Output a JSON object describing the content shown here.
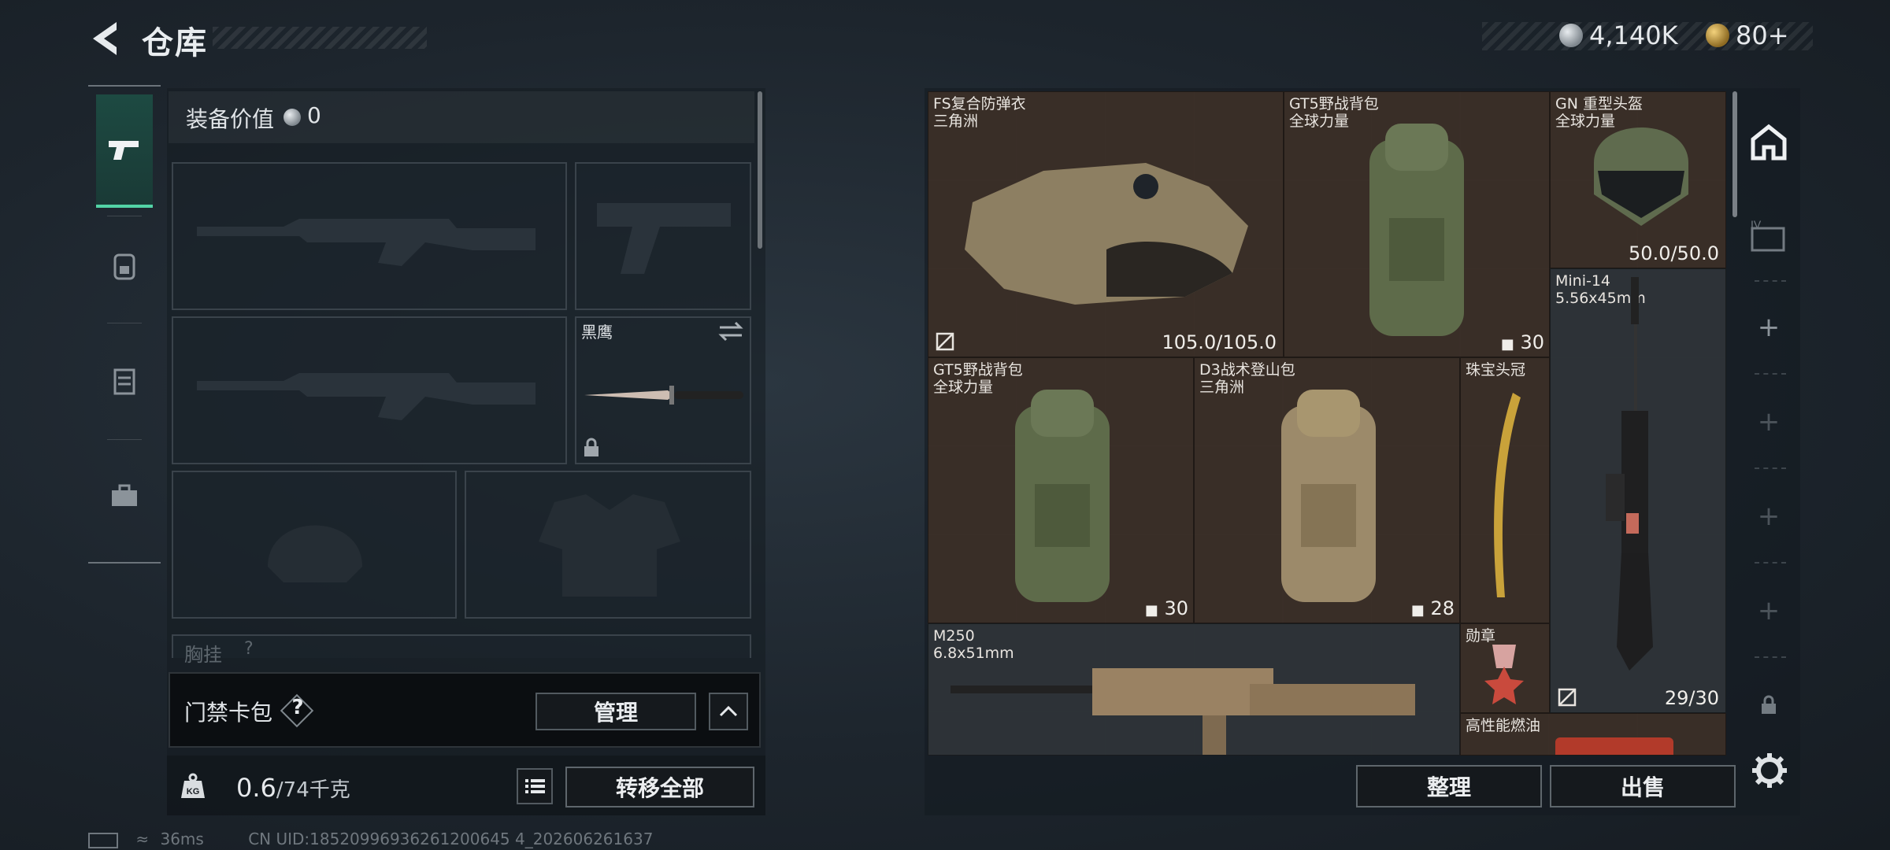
{
  "header": {
    "title": "仓库",
    "currency_silver": "4,140K",
    "currency_gold": "80+"
  },
  "nav_tabs": [
    {
      "icon": "pistol-icon",
      "active": true
    },
    {
      "icon": "backpack-icon",
      "active": false
    },
    {
      "icon": "locker-icon",
      "active": false
    },
    {
      "icon": "briefcase-icon",
      "active": false
    }
  ],
  "equipment": {
    "value_label": "装备价值",
    "value": "0",
    "knife_name": "黑鹰",
    "chest_rig_label": "胸挂",
    "chest_rig_hint": "?"
  },
  "card_pack": {
    "label": "门禁卡包",
    "help": "?",
    "manage": "管理"
  },
  "weight": {
    "current": "0.6",
    "max": "/74千克",
    "kg_badge": "KG"
  },
  "buttons": {
    "transfer_all": "转移全部",
    "organize": "整理",
    "sell": "出售"
  },
  "storage_items": [
    {
      "name": "FS复合防弹衣",
      "sub": "三角洲",
      "stat": "105.0/105.0"
    },
    {
      "name": "GT5野战背包",
      "sub": "全球力量",
      "stat": "30"
    },
    {
      "name": "GN 重型头盔",
      "sub": "全球力量",
      "stat": "50.0/50.0"
    },
    {
      "name": "Mini-14",
      "sub": "5.56x45mm",
      "stat": "29/30"
    },
    {
      "name": "GT5野战背包",
      "sub": "全球力量",
      "stat": "30"
    },
    {
      "name": "D3战术登山包",
      "sub": "三角洲",
      "stat": "28"
    },
    {
      "name": "珠宝头冠",
      "sub": "",
      "stat": ""
    },
    {
      "name": "M250",
      "sub": "6.8x51mm",
      "stat": ""
    },
    {
      "name": "勋章",
      "sub": "",
      "stat": ""
    },
    {
      "name": "高性能燃油",
      "sub": "",
      "stat": ""
    }
  ],
  "status_bar": {
    "ping": "36ms",
    "uid": "CN UID:18520996936261200645 4_202606261637"
  },
  "colors": {
    "accent": "#53d3a6",
    "item_bg": "#3a2f27",
    "panel_bg": "#141b21"
  }
}
